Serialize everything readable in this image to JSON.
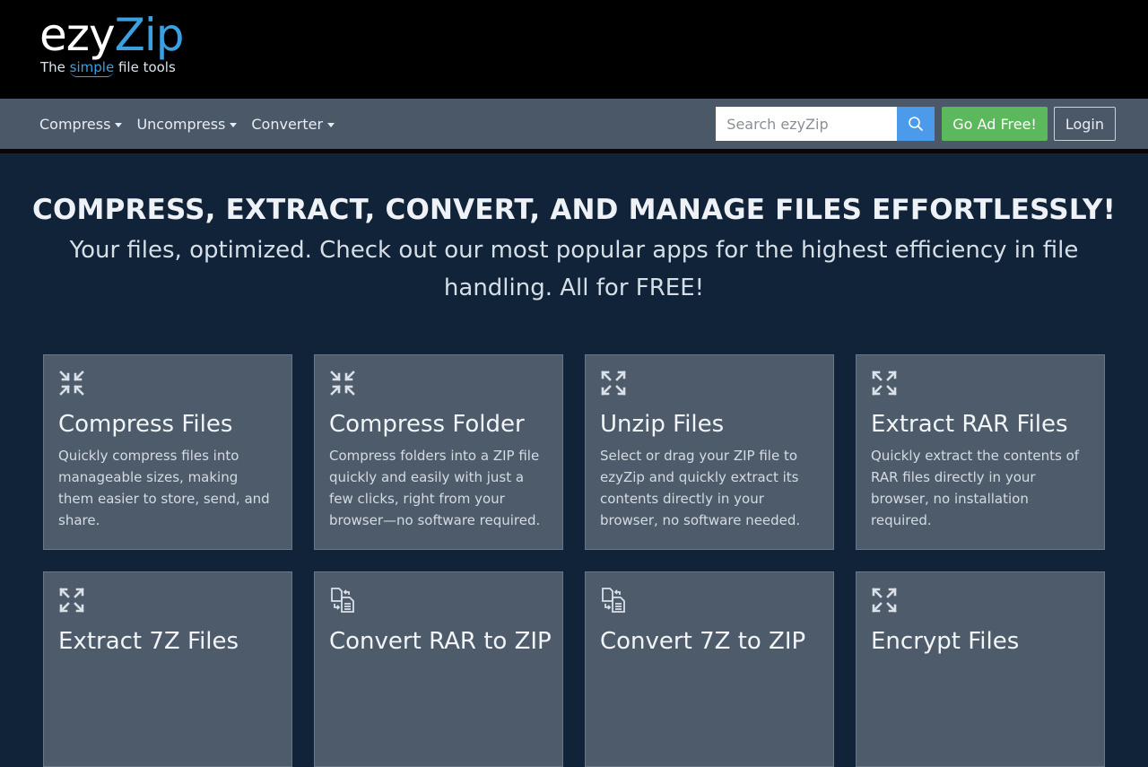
{
  "brand": {
    "name_part1": "ezy",
    "name_part2": "Zip",
    "tagline_pre": "The ",
    "tagline_highlight": "simple",
    "tagline_post": " file tools",
    "accent": "#3aa0e0"
  },
  "nav": {
    "items": [
      {
        "label": "Compress"
      },
      {
        "label": "Uncompress"
      },
      {
        "label": "Converter"
      }
    ],
    "search_placeholder": "Search ezyZip",
    "adfree_label": "Go Ad Free!",
    "login_label": "Login"
  },
  "hero": {
    "title": "COMPRESS, EXTRACT, CONVERT, AND MANAGE FILES EFFORTLESSLY!",
    "subtitle": "Your files, optimized. Check out our most popular apps for the highest efficiency in file handling. All for FREE!"
  },
  "cards": [
    {
      "icon": "compress-icon",
      "title": "Compress Files",
      "desc": "Quickly compress files into manageable sizes, making them easier to store, send, and share."
    },
    {
      "icon": "compress-icon",
      "title": "Compress Folder",
      "desc": "Compress folders into a ZIP file quickly and easily with just a few clicks, right from your browser—no software required."
    },
    {
      "icon": "expand-icon",
      "title": "Unzip Files",
      "desc": "Select or drag your ZIP file to ezyZip and quickly extract its contents directly in your browser, no software needed."
    },
    {
      "icon": "expand-icon",
      "title": "Extract RAR Files",
      "desc": "Quickly extract the contents of RAR files directly in your browser, no installation required."
    },
    {
      "icon": "expand-icon",
      "title": "Extract 7Z Files",
      "desc": ""
    },
    {
      "icon": "convert-files-icon",
      "title": "Convert RAR to ZIP",
      "desc": ""
    },
    {
      "icon": "convert-files-icon",
      "title": "Convert 7Z to ZIP",
      "desc": ""
    },
    {
      "icon": "expand-icon",
      "title": "Encrypt Files",
      "desc": ""
    }
  ]
}
